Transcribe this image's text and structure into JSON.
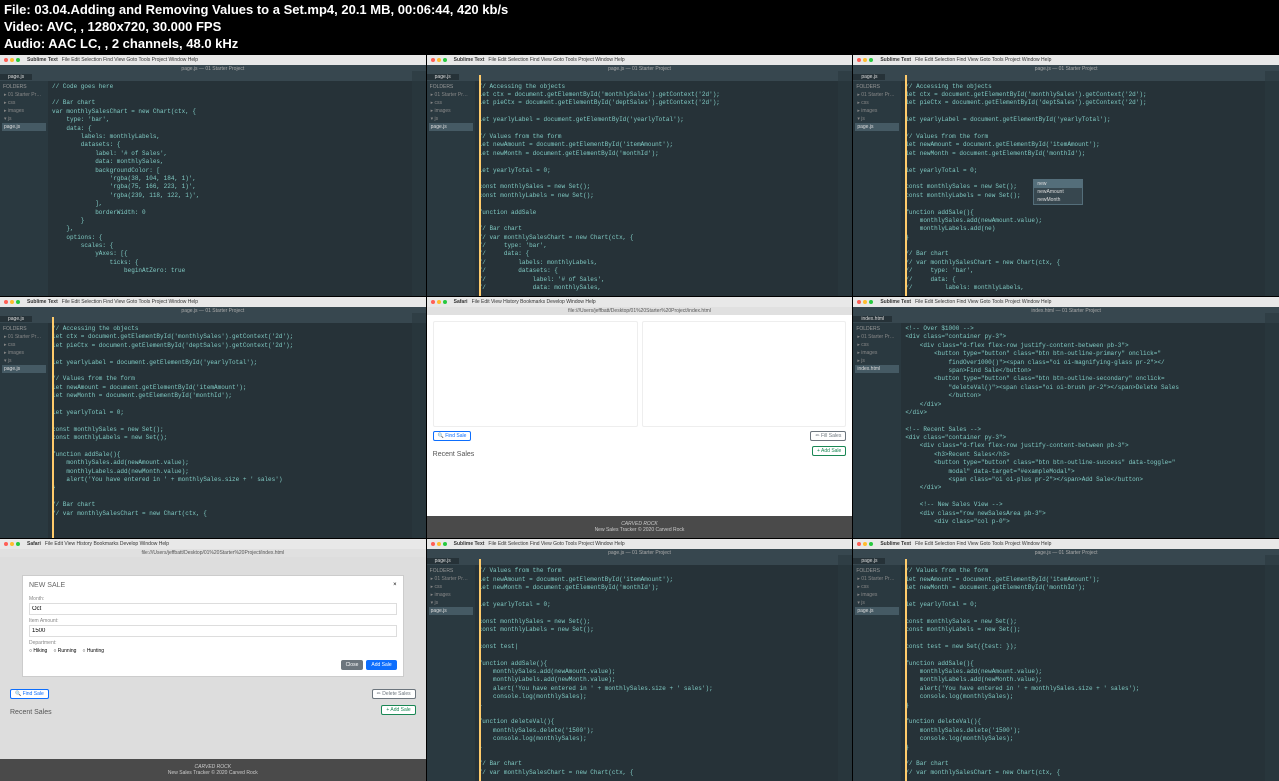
{
  "header": {
    "file": "File: 03.04.Adding and Removing Values to a Set.mp4, 20.1 MB, 00:06:44, 420 kb/s",
    "video": "Video: AVC, , 1280x720, 30.000 FPS",
    "audio": "Audio: AAC LC, , 2 channels, 48.0 kHz"
  },
  "macbar": {
    "app": "Sublime Text",
    "menus": [
      "File",
      "Edit",
      "Selection",
      "Find",
      "View",
      "Goto",
      "Tools",
      "Project",
      "Window",
      "Help"
    ],
    "safari_app": "Safari",
    "safari_menus": [
      "File",
      "Edit",
      "View",
      "History",
      "Bookmarks",
      "Develop",
      "Window",
      "Help"
    ]
  },
  "title": "page.js — 01 Starter Project",
  "title_html": "index.html — 01 Starter Project",
  "safari_url": "file:///Users/jeffbatt/Desktop/01%20Starter%20Project/index.html",
  "sidebar": {
    "label": "FOLDERS",
    "items": [
      "01 Starter Project",
      "css",
      "images",
      "js",
      "page.js"
    ],
    "html_items": [
      "01 Starter Project",
      "css",
      "images",
      "js",
      "index.html"
    ]
  },
  "tab": "page.js",
  "tab_html": "index.html",
  "cell1_code": "// Code goes here\n\n// Bar chart\nvar monthlySalesChart = new Chart(ctx, {\n    type: 'bar',\n    data: {\n        labels: monthlyLabels,\n        datasets: {\n            label: '# of Sales',\n            data: monthlySales,\n            backgroundColor: [\n                'rgba(38, 104, 184, 1)',\n                'rgba(75, 166, 223, 1)',\n                'rgba(239, 118, 122, 1)',\n            ],\n            borderWidth: 0\n        }\n    },\n    options: {\n        scales: {\n            yAxes: [{\n                ticks: {\n                    beginAtZero: true",
  "cell2_code": "// Accessing the objects\nlet ctx = document.getElementById('monthlySales').getContext('2d');\nlet pieCtx = document.getElementById('deptSales').getContext('2d');\n\nlet yearlyLabel = document.getElementById('yearlyTotal');\n\n// Values from the form\nlet newAmount = document.getElementById('itemAmount');\nlet newMonth = document.getElementById('monthId');\n\nlet yearlyTotal = 0;\n\nconst monthlySales = new Set();\nconst monthlyLabels = new Set();\n\nfunction addSale\n\n// Bar chart\n// var monthlySalesChart = new Chart(ctx, {\n//     type: 'bar',\n//     data: {\n//         labels: monthlyLabels,\n//         datasets: {\n//             label: '# of Sales',\n//             data: monthlySales,",
  "cell3_code": "// Accessing the objects\nlet ctx = document.getElementById('monthlySales').getContext('2d');\nlet pieCtx = document.getElementById('deptSales').getContext('2d');\n\nlet yearlyLabel = document.getElementById('yearlyTotal');\n\n// Values from the form\nlet newAmount = document.getElementById('itemAmount');\nlet newMonth = document.getElementById('monthId');\n\nlet yearlyTotal = 0;\n\nconst monthlySales = new Set();\nconst monthlyLabels = new Set();\n\nfunction addSale(){\n    monthlySales.add(newAmount.value);\n    monthlyLabels.add(ne)\n}\n\n// Bar chart\n// var monthlySalesChart = new Chart(ctx, {\n//     type: 'bar',\n//     data: {\n//         labels: monthlyLabels,",
  "cell3_autocomplete": [
    "new",
    "newAmount",
    "newMonth"
  ],
  "cell4_code": "// Accessing the objects\nlet ctx = document.getElementById('monthlySales').getContext('2d');\nlet pieCtx = document.getElementById('deptSales').getContext('2d');\n\nlet yearlyLabel = document.getElementById('yearlyTotal');\n\n// Values from the form\nlet newAmount = document.getElementById('itemAmount');\nlet newMonth = document.getElementById('monthId');\n\nlet yearlyTotal = 0;\n\nconst monthlySales = new Set();\nconst monthlyLabels = new Set();\n\nfunction addSale(){\n    monthlySales.add(newAmount.value);\n    monthlyLabels.add(newMonth.value);\n    alert('You have entered in ' + monthlySales.size + ' sales')\n}\n\n// Bar chart\n// var monthlySalesChart = new Chart(ctx, {",
  "cell5": {
    "find_sale": "🔍 Find Sale",
    "fill_sales": "✏ Fill Sales",
    "recent_sales": "Recent Sales",
    "add_sale": "+ Add Sale",
    "footer_brand": "CARVED ROCK",
    "footer_copy": "New Sales Tracker © 2020 Carved Rock"
  },
  "cell6_code": "<!-- Over $1000 -->\n<div class=\"container py-3\">\n    <div class=\"d-flex flex-row justify-content-between pb-3\">\n        <button type=\"button\" class=\"btn btn-outline-primary\" onclick=\"\n            findOver1000()\"><span class=\"oi oi-magnifying-glass pr-2\"></\n            span>Find Sale</button>\n        <button type=\"button\" class=\"btn btn-outline-secondary\" onclick=\n            \"deleteVal()\"><span class=\"oi oi-brush pr-2\"></span>Delete Sales\n            </button>\n    </div>\n</div>\n\n<!-- Recent Sales -->\n<div class=\"container py-3\">\n    <div class=\"d-flex flex-row justify-content-between pb-3\">\n        <h3>Recent Sales</h3>\n        <button type=\"button\" class=\"btn btn-outline-success\" data-toggle=\"\n            modal\" data-target=\"#exampleModal\">\n            <span class=\"oi oi-plus pr-2\"></span>Add Sale</button>\n    </div>\n\n    <!-- New Sales View -->\n    <div class=\"row newSalesArea pb-3\">\n        <div class=\"col p-0\">",
  "cell7": {
    "modal_title": "NEW SALE",
    "month_label": "Month:",
    "month_value": "Oct",
    "amount_label": "Item Amount:",
    "amount_value": "1500",
    "dept_label": "Department:",
    "radios": [
      "Hiking",
      "Running",
      "Hunting"
    ],
    "close": "Close",
    "add": "Add Sale",
    "find_sale": "🔍 Find Sale",
    "delete_sales": "✏ Delete Sales",
    "recent_sales": "Recent Sales",
    "add_sale_btn": "+ Add Sale",
    "footer_brand": "CARVED ROCK",
    "footer_copy": "New Sales Tracker © 2020 Carved Rock"
  },
  "cell8_code": "// Values from the form\nlet newAmount = document.getElementById('itemAmount');\nlet newMonth = document.getElementById('monthId');\n\nlet yearlyTotal = 0;\n\nconst monthlySales = new Set();\nconst monthlyLabels = new Set();\n\nconst test|\n\nfunction addSale(){\n    monthlySales.add(newAmount.value);\n    monthlyLabels.add(newMonth.value);\n    alert('You have entered in ' + monthlySales.size + ' sales');\n    console.log(monthlySales);\n}\n\nfunction deleteVal(){\n    monthlySales.delete('1500');\n    console.log(monthlySales);\n}\n\n// Bar chart\n// var monthlySalesChart = new Chart(ctx, {",
  "cell9_code": "// Values from the form\nlet newAmount = document.getElementById('itemAmount');\nlet newMonth = document.getElementById('monthId');\n\nlet yearlyTotal = 0;\n\nconst monthlySales = new Set();\nconst monthlyLabels = new Set();\n\nconst test = new Set({test: });\n\nfunction addSale(){\n    monthlySales.add(newAmount.value);\n    monthlyLabels.add(newMonth.value);\n    alert('You have entered in ' + monthlySales.size + ' sales');\n    console.log(monthlySales);\n}\n\nfunction deleteVal(){\n    monthlySales.delete('1500');\n    console.log(monthlySales);\n}\n\n// Bar chart\n// var monthlySalesChart = new Chart(ctx, {"
}
